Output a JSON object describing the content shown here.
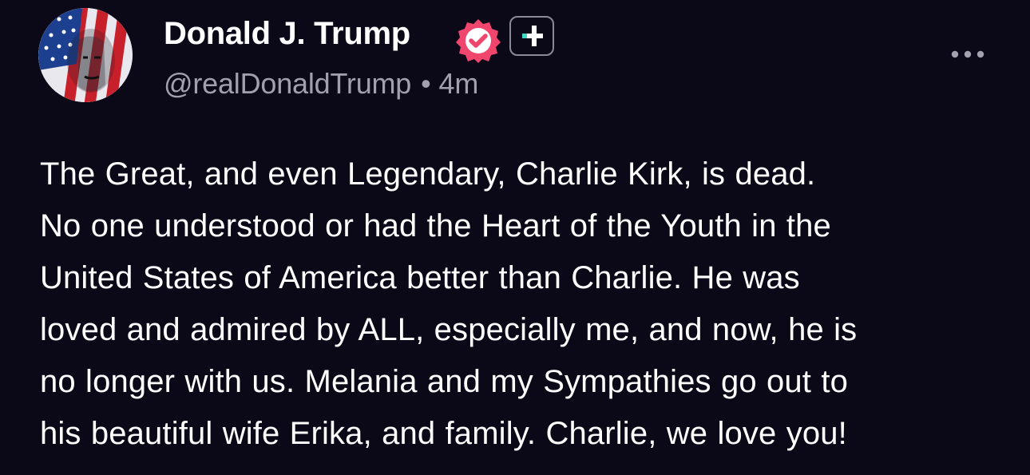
{
  "author": {
    "display_name": "Donald J. Trump",
    "handle": "@realDonaldTrump",
    "separator": "•",
    "time_ago": "4m",
    "avatar_icon": "flag-portrait-avatar",
    "verified_icon": "verified-badge-icon",
    "verified_color": "#f0466e",
    "plus_icon": "truth-plus-icon",
    "plus_accent": "#3fd6c4"
  },
  "menu": {
    "icon": "more-horizontal-icon"
  },
  "post": {
    "lines": [
      "The Great, and even Legendary, Charlie Kirk, is dead.",
      "No one understood or had the Heart of the Youth in the",
      "United States of America better than Charlie. He was",
      "loved and admired by ALL, especially me, and now, he is",
      "no longer with us. Melania and my Sympathies go out to",
      "his beautiful wife Erika, and family. Charlie, we love you!"
    ]
  },
  "colors": {
    "background": "#0b0818",
    "text": "#ffffff",
    "muted": "#a3a0ae"
  }
}
